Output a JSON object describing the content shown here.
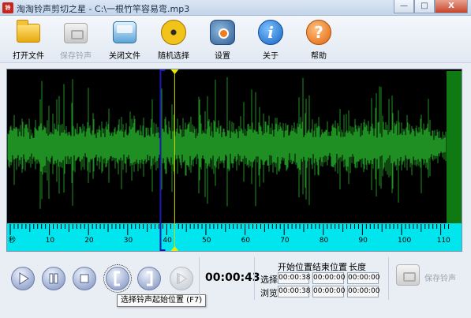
{
  "window": {
    "icon_text": "铃",
    "title": "淘淘铃声剪切之星 - C:\\一根竹竿容易弯.mp3",
    "minimize": "—",
    "maximize": "□",
    "close": "X"
  },
  "toolbar": {
    "items": [
      {
        "label": "打开文件",
        "icon": "folder-icon",
        "enabled": true
      },
      {
        "label": "保存铃声",
        "icon": "phone-icon",
        "enabled": false
      },
      {
        "label": "关闭文件",
        "icon": "window-icon",
        "enabled": true
      },
      {
        "label": "随机选择",
        "icon": "radiation-icon",
        "enabled": true
      },
      {
        "label": "设置",
        "icon": "settings-icon",
        "enabled": true
      },
      {
        "label": "关于",
        "icon": "info-icon",
        "enabled": true,
        "glyph": "i"
      },
      {
        "label": "帮助",
        "icon": "help-icon",
        "enabled": true,
        "glyph": "?"
      }
    ]
  },
  "waveform": {
    "background": "#000000",
    "wave_color": "#1f8f23",
    "end_marker_color": "#0f7a12",
    "ruler_color": "#00e5ee",
    "ruler_unit": "秒",
    "ruler_labels": [
      "10",
      "20",
      "30",
      "40",
      "50",
      "60",
      "70",
      "80",
      "90",
      "100",
      "110"
    ],
    "selection_start_seconds": 38,
    "selection_end_seconds": 38,
    "playhead_seconds": 40,
    "total_seconds": 112
  },
  "playback": {
    "buttons": [
      {
        "name": "play-button",
        "icon": "play-icon",
        "enabled": true
      },
      {
        "name": "pause-button",
        "icon": "pause-icon",
        "enabled": true
      },
      {
        "name": "stop-button",
        "icon": "stop-icon",
        "enabled": true
      },
      {
        "name": "set-start-button",
        "icon": "left-bracket-icon",
        "enabled": true,
        "glyph": "["
      },
      {
        "name": "set-end-button",
        "icon": "right-bracket-icon",
        "enabled": true,
        "glyph": "]"
      },
      {
        "name": "play-selection-button",
        "icon": "play-selection-icon",
        "enabled": false
      }
    ],
    "tooltip": "选择铃声起始位置 (F7)",
    "current_time": "00:00:43"
  },
  "position_info": {
    "header_start": "开始位置",
    "header_end": "结束位置",
    "header_length": "长度",
    "row_select_label": "选择",
    "row_browse_label": "浏览",
    "select_start": "00:00:38",
    "select_end": "00:00:00",
    "select_length": "00:00:00",
    "browse_start": "00:00:38",
    "browse_end": "00:00:00",
    "browse_length": "00:00:00"
  },
  "save_ringtone": {
    "label": "保存铃声",
    "enabled": false
  }
}
